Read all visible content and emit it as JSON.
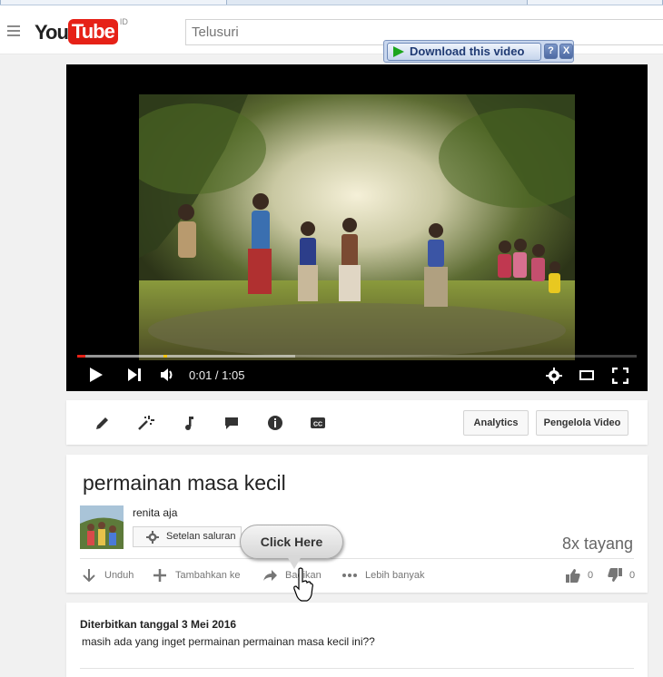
{
  "masthead": {
    "logo_you": "You",
    "logo_tube": "Tube",
    "logo_region": "ID",
    "search_placeholder": "Telusuri"
  },
  "download_toolbar": {
    "download_label": "Download this video",
    "help_label": "?",
    "close_label": "X"
  },
  "player": {
    "time_display": "0:01 / 1:05",
    "progress_played_fraction": 0.015,
    "progress_loaded_fraction": 0.39
  },
  "creator_toolbar": {
    "tools": [
      "edit-icon",
      "enhance-icon",
      "audio-icon",
      "annotations-icon",
      "info-icon",
      "captions-icon"
    ],
    "analytics_label": "Analytics",
    "video_manager_label": "Pengelola Video"
  },
  "video_info": {
    "title": "permainan masa kecil",
    "channel_name": "renita aja",
    "channel_settings_label": "Setelan saluran",
    "view_count": "8x tayang",
    "actions": {
      "download": "Unduh",
      "add_to": "Tambahkan ke",
      "share": "Bagikan",
      "more": "Lebih banyak",
      "like_count": "0",
      "dislike_count": "0"
    }
  },
  "callout": {
    "label": "Click Here"
  },
  "description": {
    "published": "Diterbitkan tanggal 3 Mei 2016",
    "text": "masih ada yang inget permainan permainan masa kecil ini??"
  },
  "colors": {
    "brand_red": "#e62117",
    "page_bg": "#f1f1f1",
    "download_green": "#1ca51c"
  }
}
